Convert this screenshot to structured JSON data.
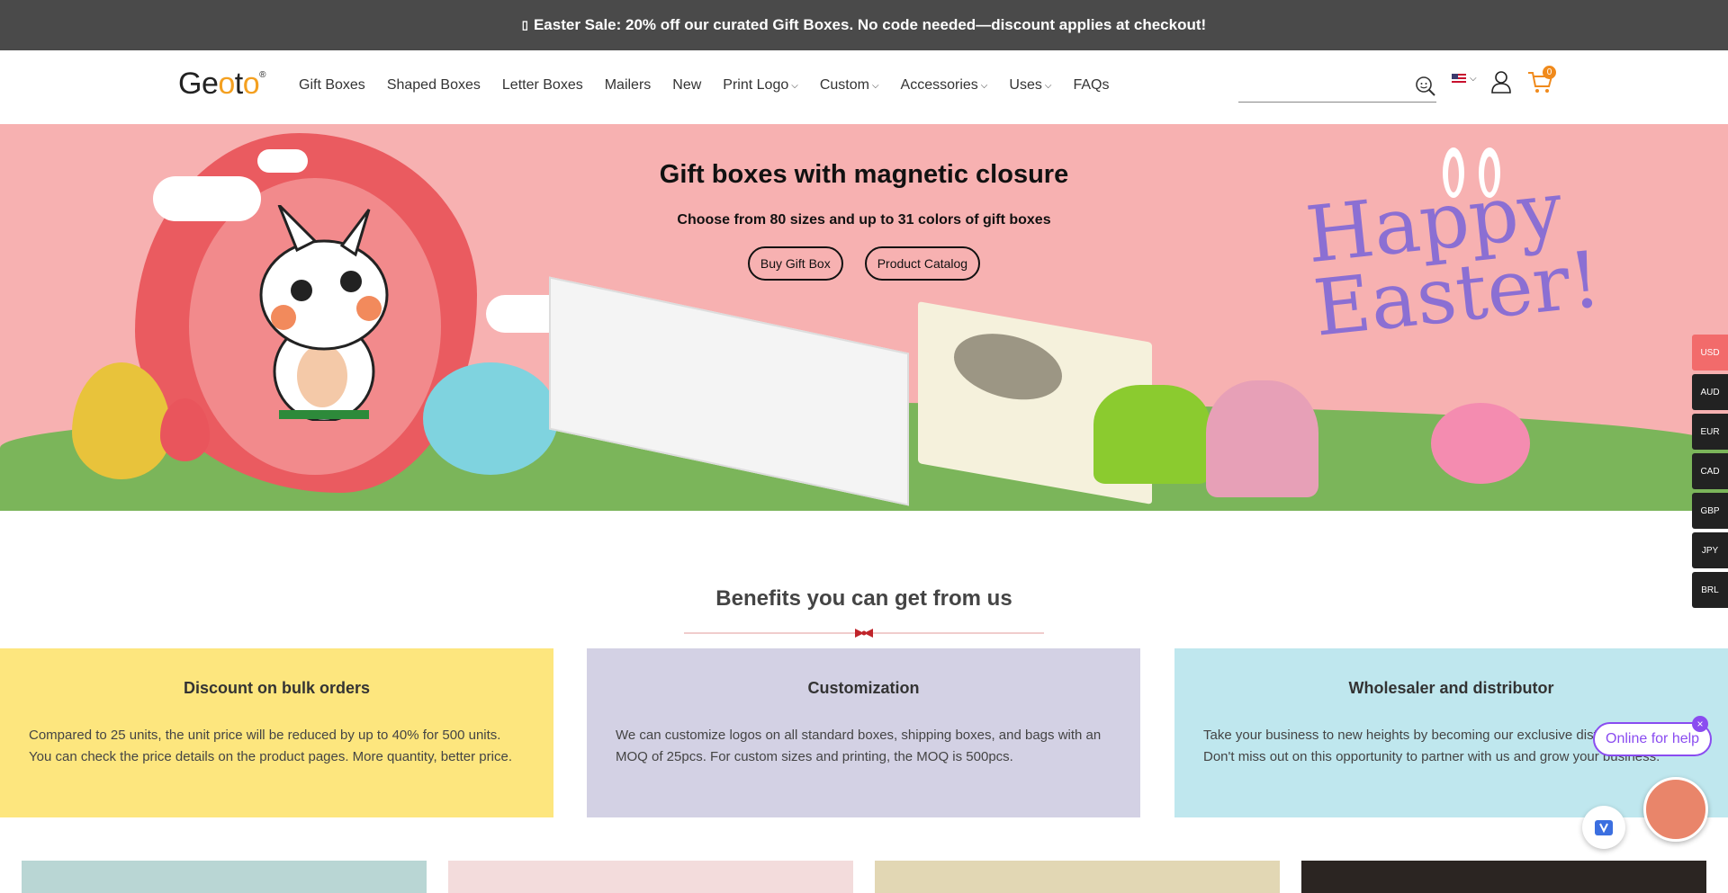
{
  "announcement": {
    "icon": "gift-icon",
    "text": "Easter Sale: 20% off our curated Gift Boxes. No code needed—discount applies at checkout!"
  },
  "header": {
    "logo": "Geoto",
    "nav": [
      {
        "label": "Gift Boxes",
        "dropdown": false
      },
      {
        "label": "Shaped Boxes",
        "dropdown": false
      },
      {
        "label": "Letter Boxes",
        "dropdown": false
      },
      {
        "label": "Mailers",
        "dropdown": false
      },
      {
        "label": "New",
        "dropdown": false
      },
      {
        "label": "Print Logo",
        "dropdown": true
      },
      {
        "label": "Custom",
        "dropdown": true
      },
      {
        "label": "Accessories",
        "dropdown": true
      },
      {
        "label": "Uses",
        "dropdown": true
      },
      {
        "label": "FAQs",
        "dropdown": false
      }
    ],
    "search": {
      "value": "",
      "placeholder": ""
    },
    "cart_count": "0"
  },
  "hero": {
    "title": "Gift boxes with magnetic closure",
    "subtitle": "Choose from 80 sizes and up to 31 colors of gift boxes",
    "buttons": [
      "Buy Gift Box",
      "Product Catalog"
    ],
    "art_text": "Happy Easter!",
    "art_label_small": "Happy Easter"
  },
  "currencies": [
    "USD",
    "AUD",
    "EUR",
    "CAD",
    "GBP",
    "JPY",
    "BRL"
  ],
  "active_currency": "USD",
  "benefits": {
    "title": "Benefits you can get from us",
    "cards": [
      {
        "title": "Discount on bulk orders",
        "text": "Compared to 25 units, the unit price will be reduced by up to 40% for 500 units. You can check the price details on the product pages. More quantity, better price."
      },
      {
        "title": "Customization",
        "text": "We can customize logos on all standard boxes, shipping boxes, and bags with an MOQ of 25pcs. For custom sizes and printing, the MOQ is 500pcs."
      },
      {
        "title": "Wholesaler and distributor",
        "text": "Take your business to new heights by becoming our exclusive distributor today. Don't miss out on this opportunity to partner with us and grow your business."
      }
    ]
  },
  "chat": {
    "bubble": "Online for help",
    "close": "×"
  },
  "colors": {
    "announce_bg": "#4a4a4a",
    "hero_bg": "#f7b1b1",
    "accent_cart": "#f08a1c",
    "chat_purple": "#8a4cf0",
    "currency_active": "#f26b6b"
  }
}
